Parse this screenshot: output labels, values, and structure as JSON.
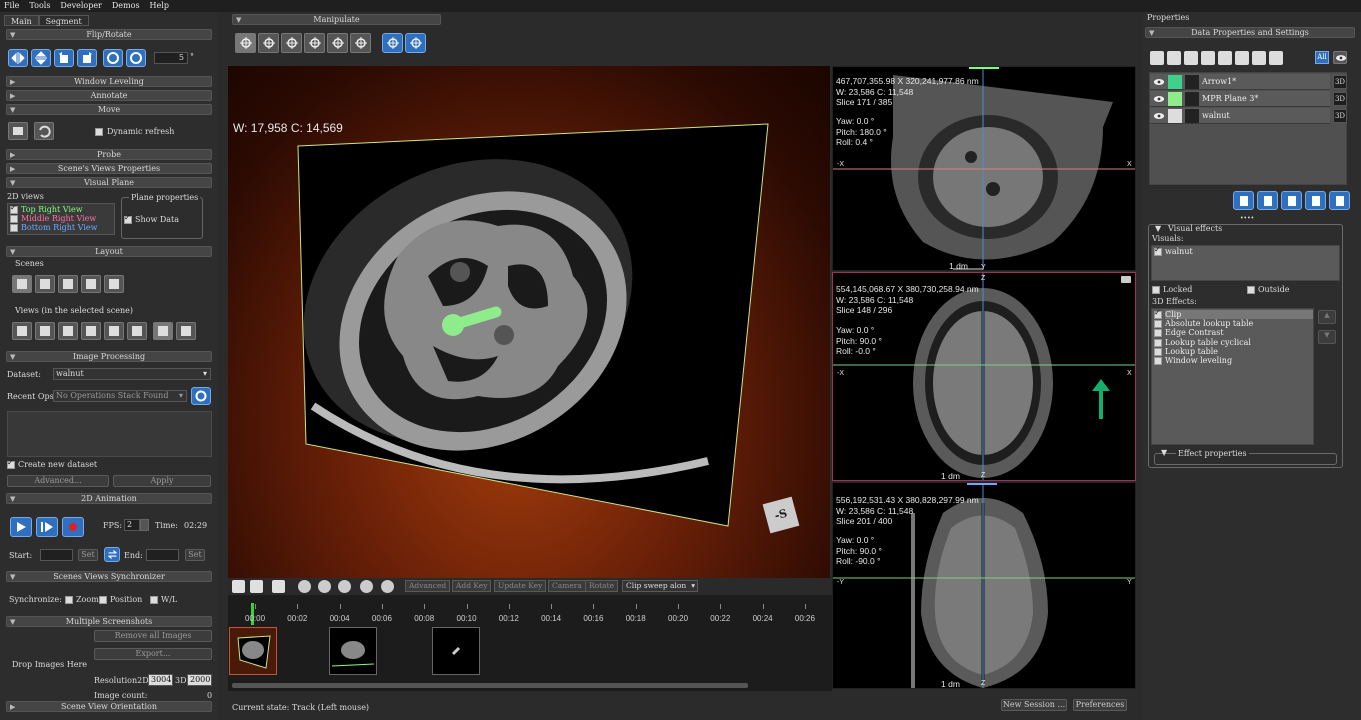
{
  "menu": [
    "File",
    "Tools",
    "Developer",
    "Demos",
    "Help"
  ],
  "left_tabs": [
    "Main",
    "Segment"
  ],
  "sections": {
    "flip_rotate": "Flip/Rotate",
    "window_leveling": "Window Leveling",
    "annotate": "Annotate",
    "move": "Move",
    "probe": "Probe",
    "scene_views_properties": "Scene's Views Properties",
    "visual_plane": "Visual Plane",
    "layout": "Layout",
    "image_processing": "Image Processing",
    "animation_2d": "2D Animation",
    "scenes_sync": "Scenes Views Synchronizer",
    "multiple_screenshots": "Multiple Screenshots",
    "scene_view_orientation": "Scene View Orientation"
  },
  "flip_rotate": {
    "angle": "5",
    "unit": "°"
  },
  "move": {
    "dynamic_refresh": "Dynamic refresh"
  },
  "visual_plane": {
    "views_label": "2D views",
    "views": [
      {
        "label": "Top Right View",
        "checked": true,
        "color": "#7fff7f"
      },
      {
        "label": "Middle Right View",
        "checked": false,
        "color": "#ff6fa8"
      },
      {
        "label": "Bottom Right View",
        "checked": false,
        "color": "#6fa8ff"
      }
    ],
    "plane_properties": "Plane properties",
    "show_data": "Show Data"
  },
  "layout": {
    "scenes": "Scenes",
    "views_in_scene": "Views (in the selected scene)"
  },
  "image_processing": {
    "dataset_label": "Dataset:",
    "dataset_value": "walnut",
    "recent_ops_label": "Recent Ops",
    "recent_ops_value": "No Operations Stack Found",
    "create_new_dataset": "Create new dataset",
    "advanced": "Advanced...",
    "apply": "Apply"
  },
  "animation": {
    "fps_label": "FPS:",
    "fps_value": "2",
    "time_label": "Time:",
    "time_value": "02:29",
    "start_label": "Start:",
    "end_label": "End:",
    "set": "Set"
  },
  "sync": {
    "label": "Synchronize:",
    "zoom": "Zoom",
    "position": "Position",
    "wl": "W/L"
  },
  "screenshots": {
    "remove_all": "Remove all Images",
    "export": "Export...",
    "drop_images": "Drop Images Here",
    "resolution_label": "Resolution2D:",
    "res_2d": "3004",
    "res_3d_label": "3D:",
    "res_3d": "2000",
    "image_count_label": "Image count:",
    "image_count": "0"
  },
  "manipulate": "Manipulate",
  "main_view": {
    "wl": "W: 17,958 C: 14,569"
  },
  "views": [
    {
      "coords": "467,707,355.98 X 320,241,977.86 nm",
      "wl": "W: 23,586 C: 11,548",
      "slice": "Slice 171 / 385",
      "yaw": "Yaw: 0.0 °",
      "pitch": "Pitch: 180.0 °",
      "roll": "Roll: 0.4 °",
      "left_axis": "-X",
      "right_axis": "X",
      "bottom_axis": "Y",
      "scale": "1 dm"
    },
    {
      "coords": "554,145,068.67 X 380,730,258.94 nm",
      "wl": "W: 23,586 C: 11,548",
      "slice": "Slice 148 / 296",
      "yaw": "Yaw: 0.0 °",
      "pitch": "Pitch: 90.0 °",
      "roll": "Roll: -0.0 °",
      "left_axis": "-X",
      "right_axis": "X",
      "top_axis": "Z",
      "bottom_axis": "Z",
      "scale": "1 dm"
    },
    {
      "coords": "556,192,531.43 X 380,828,297.99 nm",
      "wl": "W: 23,586 C: 11,548",
      "slice": "Slice 201 / 400",
      "yaw": "Yaw: 0.0 °",
      "pitch": "Pitch: 90.0 °",
      "roll": "Roll: -90.0 °",
      "left_axis": "-Y",
      "right_axis": "Y",
      "bottom_axis": "Z",
      "scale": "1 dm"
    }
  ],
  "timeline_toolbar": {
    "advanced": "Advanced",
    "add_key": "Add Key",
    "update_key": "Update Key",
    "camera": "Camera",
    "rotate": "Rotate",
    "clip": "Clip sweep alon"
  },
  "timeline": {
    "ticks": [
      "00:00",
      "00:02",
      "00:04",
      "00:06",
      "00:08",
      "00:10",
      "00:12",
      "00:14",
      "00:16",
      "00:18",
      "00:20",
      "00:22",
      "00:24",
      "00:26"
    ]
  },
  "status": {
    "current_state": "Current state: Track (Left mouse)",
    "new_session": "New Session ...",
    "preferences": "Preferences"
  },
  "properties": {
    "title": "Properties",
    "data_props": "Data Properties and Settings",
    "all": "All",
    "items": [
      {
        "name": "Arrow1*",
        "badge": "3D"
      },
      {
        "name": "MPR Plane 3*",
        "badge": "3D"
      },
      {
        "name": "walnut",
        "badge": "3D"
      }
    ],
    "dots": "••••",
    "visual_effects": "Visual effects",
    "visuals_label": "Visuals:",
    "visuals": [
      "walnut"
    ],
    "locked": "Locked",
    "outside": "Outside",
    "effects_label": "3D Effects:",
    "effects": [
      {
        "label": "Clip",
        "checked": true
      },
      {
        "label": "Absolute lookup table",
        "checked": false
      },
      {
        "label": "Edge Contrast",
        "checked": false
      },
      {
        "label": "Lookup table cyclical",
        "checked": false
      },
      {
        "label": "Lookup table",
        "checked": false
      },
      {
        "label": "Window leveling",
        "checked": false
      }
    ],
    "effect_properties": "Effect properties"
  },
  "colors": {
    "accent": "#2f6fbf",
    "green": "#7fff7f",
    "pink_border": "#a0305a",
    "arrow": "#12b06a"
  }
}
